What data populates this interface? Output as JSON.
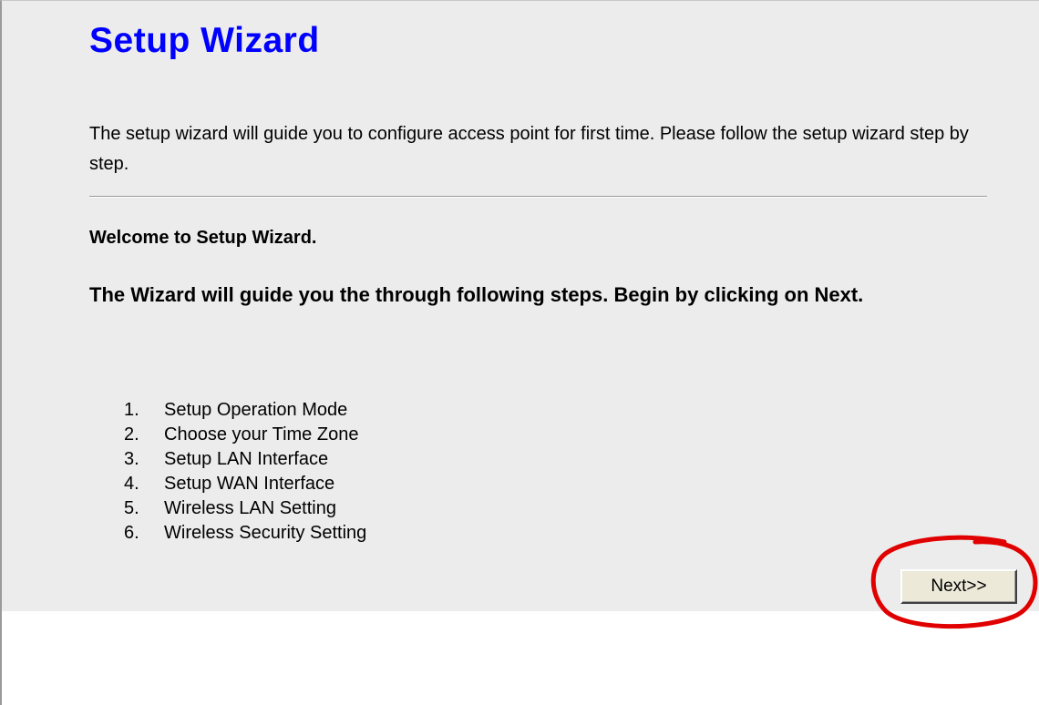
{
  "wizard": {
    "title": "Setup Wizard",
    "intro": "The setup wizard will guide you to configure access point for first time. Please follow the setup wizard step by step.",
    "welcome": "Welcome to Setup Wizard.",
    "guide": "The Wizard will guide you the through following steps. Begin by clicking on Next.",
    "steps": [
      {
        "num": "1.",
        "label": "Setup Operation Mode"
      },
      {
        "num": "2.",
        "label": "Choose your Time Zone"
      },
      {
        "num": "3.",
        "label": "Setup LAN Interface"
      },
      {
        "num": "4.",
        "label": "Setup WAN Interface"
      },
      {
        "num": "5.",
        "label": "Wireless LAN Setting"
      },
      {
        "num": "6.",
        "label": "Wireless Security Setting"
      }
    ],
    "next_label": "Next>>"
  },
  "colors": {
    "title": "#0000ff",
    "panel_bg": "#ececec",
    "highlight": "#e00000",
    "button_bg": "#ece9d8"
  }
}
